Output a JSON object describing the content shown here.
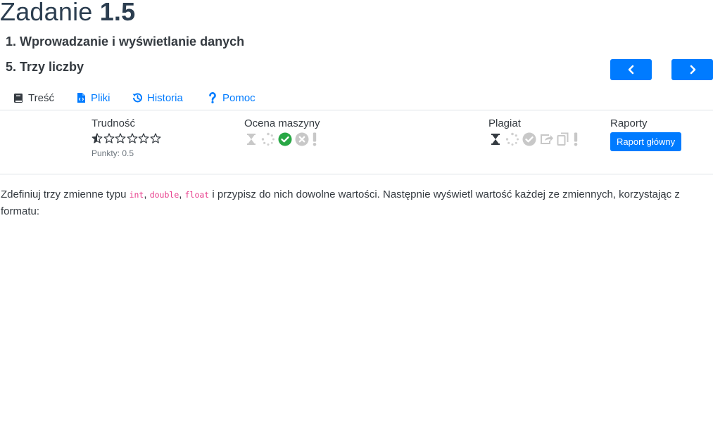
{
  "header": {
    "title_word": "Zadanie",
    "title_number": "1.5",
    "section": "1. Wprowadzanie i wyświetlanie danych",
    "task": "5. Trzy liczby"
  },
  "nav": {
    "prev_icon": "chevron-left-icon",
    "next_icon": "chevron-right-icon"
  },
  "tabs": [
    {
      "label": "Treść",
      "icon": "book-icon"
    },
    {
      "label": "Pliki",
      "icon": "file-code-icon"
    },
    {
      "label": "Historia",
      "icon": "history-icon"
    },
    {
      "label": "Pomoc",
      "icon": "question-icon"
    }
  ],
  "info": {
    "difficulty": {
      "label": "Trudność",
      "rating": 0.5,
      "max": 6,
      "points": "Punkty: 0.5"
    },
    "machine": {
      "label": "Ocena maszyny",
      "icons": [
        "hourglass-icon",
        "spinner-icon",
        "check-circle-icon",
        "times-circle-icon",
        "exclamation-icon"
      ],
      "active": "check-circle-icon"
    },
    "plagiarism": {
      "label": "Plagiat",
      "icons": [
        "hourglass-icon",
        "spinner-icon",
        "check-circle-icon",
        "share-icon",
        "copy-icon",
        "exclamation-icon"
      ],
      "active": "hourglass-icon"
    },
    "reports": {
      "label": "Raporty",
      "button": "Raport główny"
    }
  },
  "content": {
    "p1": "Zdefiniuj trzy zmienne typu ",
    "code1": "int",
    "sep1": ", ",
    "code2": "double",
    "sep2": ", ",
    "code3": "float",
    "p2": " i przypisz do nich dowolne wartości. Następnie wyświetl wartość każdej ze zmiennych, korzystając z formatu:"
  },
  "colors": {
    "primary": "#007bff",
    "success": "#28a745",
    "muted": "#c8c8c8",
    "code": "#e83e8c"
  }
}
